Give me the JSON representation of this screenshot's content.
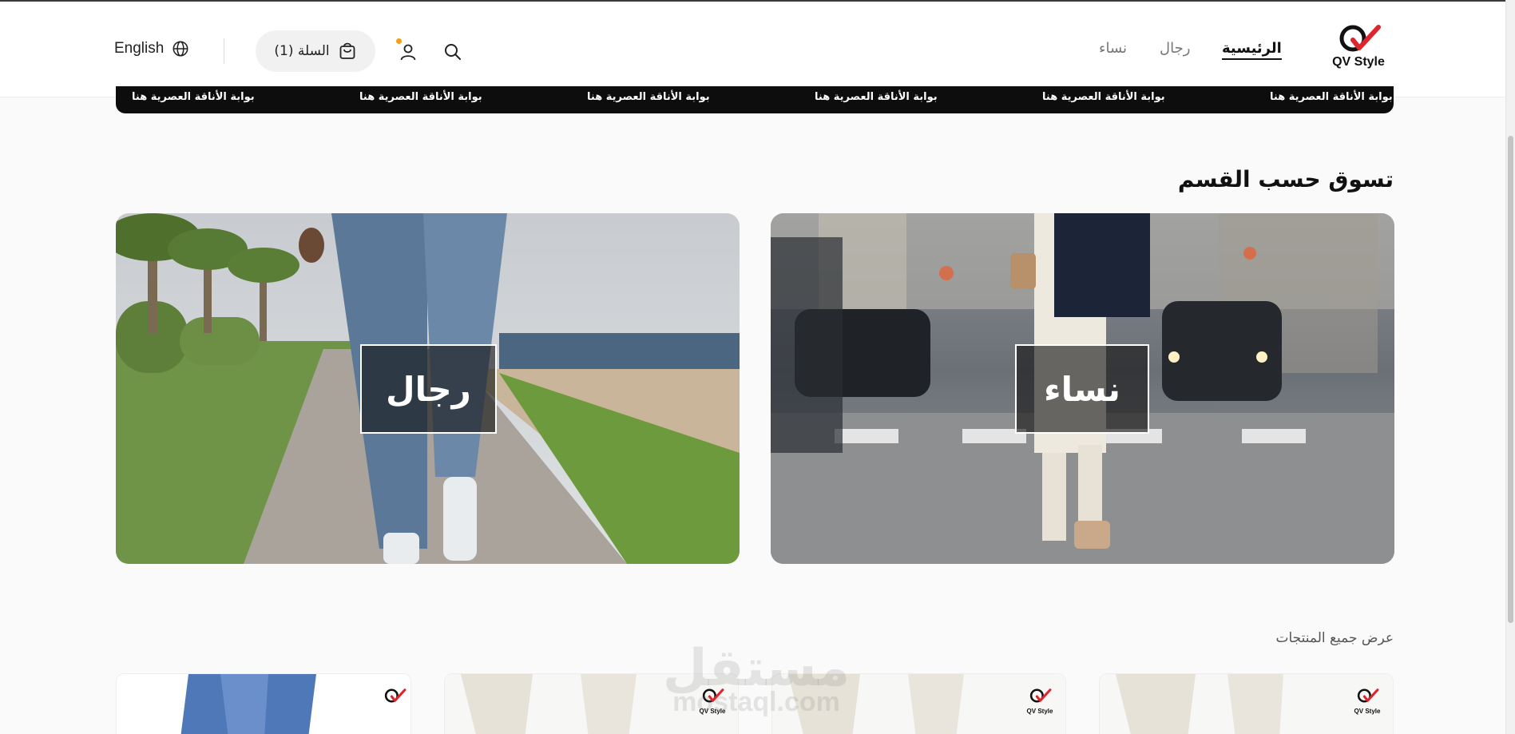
{
  "header": {
    "logo_text": "QV Style",
    "nav": [
      {
        "label": "الرئيسية",
        "active": true
      },
      {
        "label": "رجال",
        "active": false
      },
      {
        "label": "نساء",
        "active": false
      }
    ],
    "cart_label": "السلة (1)",
    "language_label": "English"
  },
  "marquee": {
    "text": "بوابة الأناقة العصرية هنا"
  },
  "categories": {
    "title": "تسوق حسب القسم",
    "items": [
      {
        "label": "نساء"
      },
      {
        "label": "رجال"
      }
    ]
  },
  "products": {
    "view_all": "عرض جميع المنتجات",
    "logo_text": "QV Style"
  },
  "watermark": {
    "arabic": "مستقل",
    "latin": "mostaql.com"
  },
  "colors": {
    "accent_red": "#e0242c",
    "notification_dot": "#f0a020"
  }
}
